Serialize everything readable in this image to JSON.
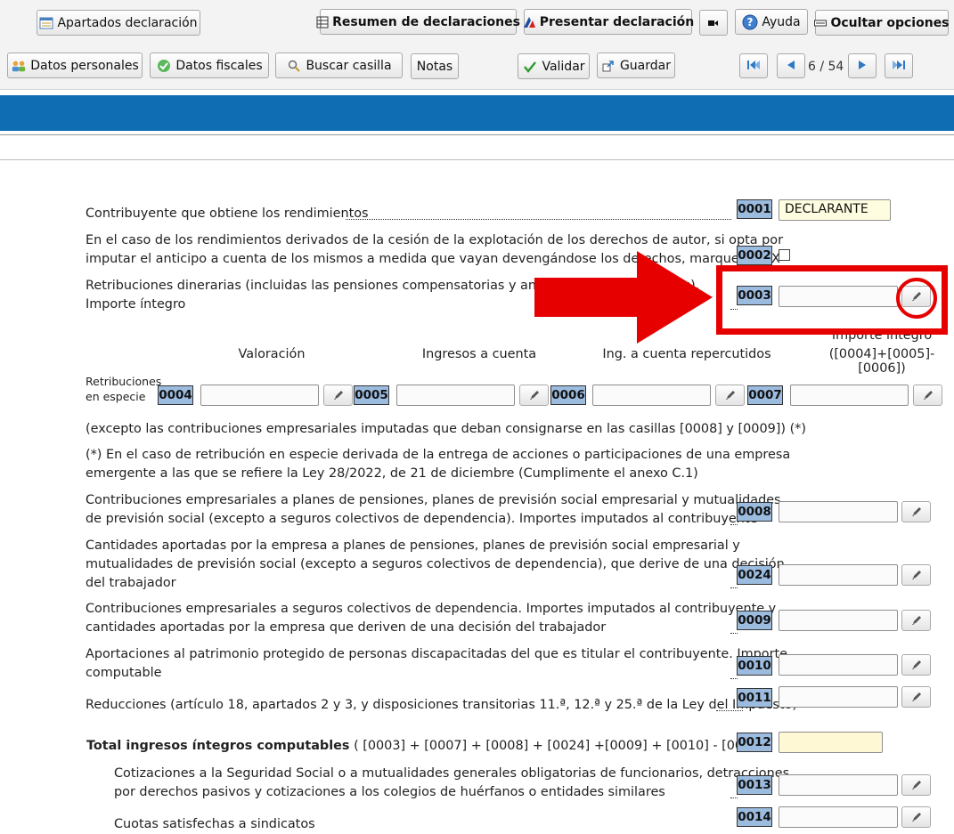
{
  "toolbar": {
    "apartados": "Apartados declaración",
    "resumen": "Resumen de declaraciones",
    "presentar": "Presentar declaración",
    "ayuda": "Ayuda",
    "ocultar": "Ocultar opciones",
    "datos_personales": "Datos personales",
    "datos_fiscales": "Datos fiscales",
    "buscar": "Buscar casilla",
    "notas": "Notas",
    "validar": "Validar",
    "guardar": "Guardar",
    "page_indicator": "6 / 54"
  },
  "form": {
    "c0001": {
      "label": "Contribuyente que obtiene los rendimientos",
      "code": "0001",
      "value": "DECLARANTE"
    },
    "c0002": {
      "label1": "En el caso de los rendimientos derivados de la cesión de la explotación de los derechos de autor, si opta por",
      "label2": "imputar el anticipo a cuenta de los mismos a medida que vayan devengándose los derechos, marque una X",
      "code": "0002"
    },
    "c0003": {
      "label1": "Retribuciones dinerarias (incluidas las pensiones compensatorias y anualidades por alimentos).",
      "label2": "Importe íntegro",
      "code": "0003"
    },
    "especie": {
      "row_label1": "Retribuciones",
      "row_label2": "en especie",
      "col_valoracion": "Valoración",
      "col_ingresos": "Ingresos a cuenta",
      "col_repercutidos": "Ing. a cuenta repercutidos",
      "col_integro1": "Importe íntegro",
      "col_integro2": "([0004]+[0005]-[0006])",
      "codes": [
        "0004",
        "0005",
        "0006",
        "0007"
      ]
    },
    "note1": "(excepto las contribuciones empresariales imputadas que deban consignarse en las casillas [0008] y [0009]) (*)",
    "note2a": "(*) En el caso de retribución en especie derivada de la entrega de acciones o participaciones de una empresa",
    "note2b": "emergente a las que se refiere la Ley 28/2022, de 21 de diciembre (Cumplimente el anexo C.1)",
    "c0008": {
      "label1": "Contribuciones empresariales a planes de pensiones, planes de previsión social empresarial y mutualidades",
      "label2": "de previsión social (excepto a seguros colectivos de dependencia). Importes imputados al contribuyente",
      "code": "0008"
    },
    "c0024": {
      "label1": "Cantidades aportadas por la empresa a planes de pensiones, planes de previsión social empresarial y",
      "label2": "mutualidades de previsión social (excepto a seguros colectivos de dependencia), que derive de una decisión",
      "label3": "del trabajador",
      "code": "0024"
    },
    "c0009": {
      "label1": "Contribuciones empresariales a seguros colectivos de dependencia. Importes imputados al contribuyente y",
      "label2": "cantidades aportadas por la empresa que deriven de una decisión del trabajador",
      "code": "0009"
    },
    "c0010": {
      "label1": "Aportaciones al patrimonio protegido de personas discapacitadas del que es titular el contribuyente. Importe",
      "label2": "computable",
      "code": "0010"
    },
    "c0011": {
      "label": "Reducciones (artículo 18, apartados 2 y 3, y disposiciones transitorias 11.ª, 12.ª y 25.ª de la Ley del Impuesto)",
      "code": "0011"
    },
    "c0012": {
      "label_bold": "Total ingresos íntegros computables",
      "label_formula": "( [0003] + [0007] + [0008] + [0024] +[0009] + [0010] - [0011] )",
      "code": "0012"
    },
    "c0013": {
      "label1": "Cotizaciones a la Seguridad Social o a mutualidades generales obligatorias de funcionarios, detracciones",
      "label2": "por derechos pasivos y cotizaciones a los colegios de huérfanos o entidades similares",
      "code": "0013"
    },
    "c0014": {
      "label": "Cuotas satisfechas a sindicatos",
      "code": "0014"
    }
  },
  "colors": {
    "band": "#0e6db3",
    "code_bg": "#9bbbdf",
    "highlight": "#e60000"
  }
}
